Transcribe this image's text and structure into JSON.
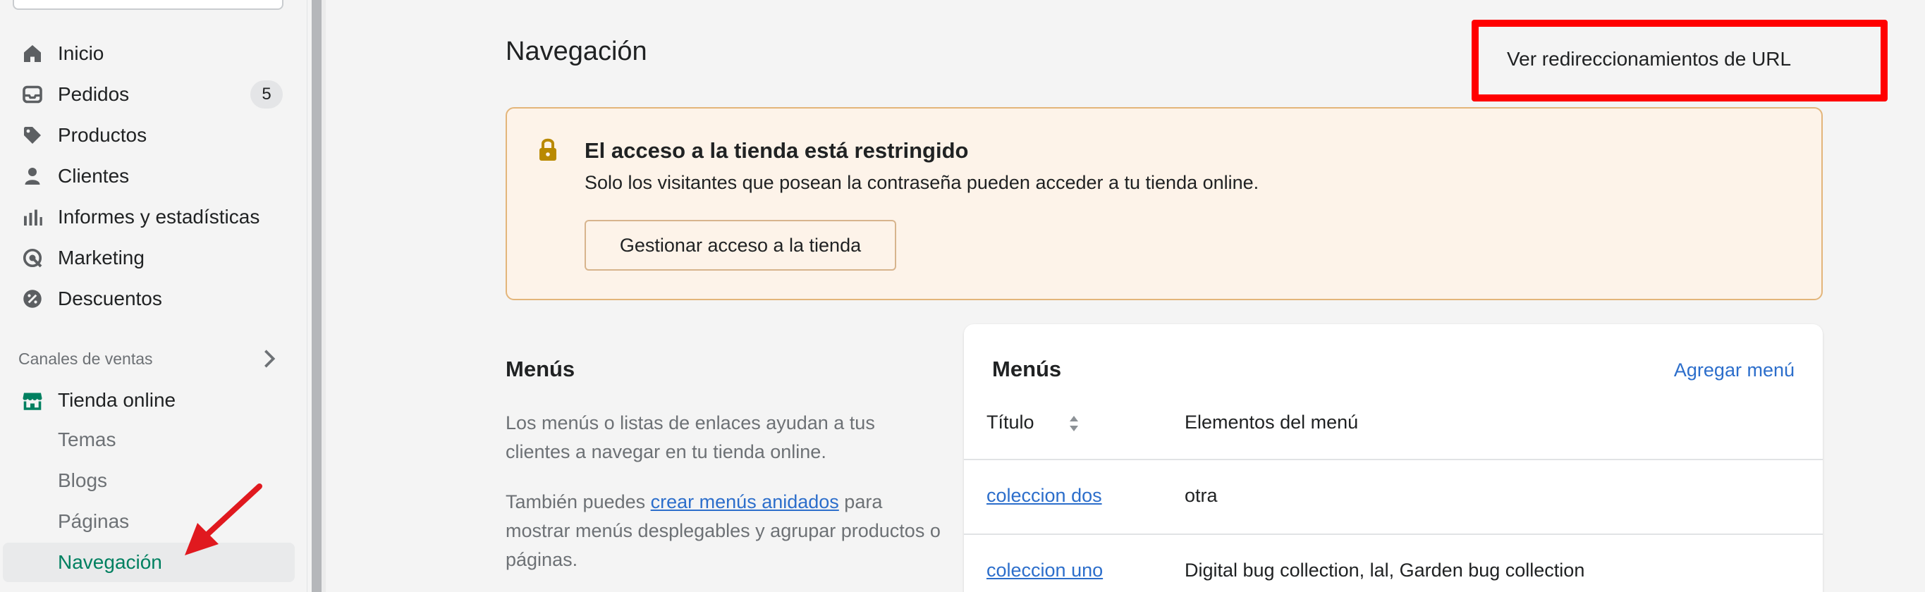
{
  "sidebar": {
    "items": [
      {
        "label": "Inicio",
        "icon": "home-icon"
      },
      {
        "label": "Pedidos",
        "icon": "orders-icon",
        "badge": "5"
      },
      {
        "label": "Productos",
        "icon": "tag-icon"
      },
      {
        "label": "Clientes",
        "icon": "person-icon"
      },
      {
        "label": "Informes y estadísticas",
        "icon": "analytics-icon"
      },
      {
        "label": "Marketing",
        "icon": "marketing-icon"
      },
      {
        "label": "Descuentos",
        "icon": "discount-icon"
      }
    ],
    "sales_channels_title": "Canales de ventas",
    "online_store": {
      "label": "Tienda online",
      "icon": "store-icon"
    },
    "sub_items": [
      "Temas",
      "Blogs",
      "Páginas",
      "Navegación"
    ]
  },
  "page": {
    "title": "Navegación",
    "redirect_button": "Ver redireccionamientos de URL"
  },
  "banner": {
    "title": "El acceso a la tienda está restringido",
    "text": "Solo los visitantes que posean la contraseña pueden acceder a tu tienda online.",
    "button": "Gestionar acceso a la tienda"
  },
  "menus_section": {
    "heading": "Menús",
    "description": "Los menús o listas de enlaces ayudan a tus clientes a navegar en tu tienda online.",
    "description2_prefix": "También puedes ",
    "description2_link": "crear menús anidados",
    "description2_suffix": " para mostrar menús desplegables y agrupar productos o páginas."
  },
  "menus_card": {
    "title": "Menús",
    "add_link": "Agregar menú",
    "columns": [
      "Título",
      "Elementos del menú"
    ],
    "rows": [
      {
        "title": "coleccion dos",
        "items": "otra"
      },
      {
        "title": "coleccion uno",
        "items": "Digital bug collection, lal, Garden bug collection"
      }
    ]
  },
  "colors": {
    "accent_green": "#008060",
    "link_blue": "#2c6ecb",
    "highlight_red": "#ff0000",
    "banner_bg": "#fdf3e9"
  }
}
